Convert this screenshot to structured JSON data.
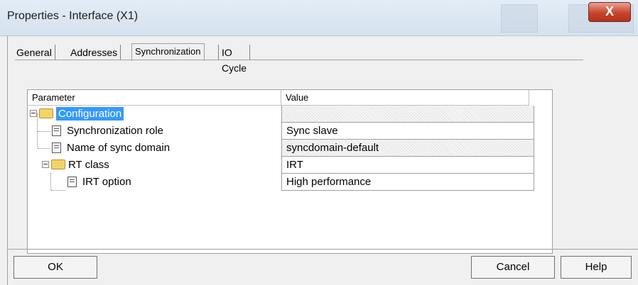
{
  "window": {
    "title": "Properties - Interface (X1)",
    "close_label": "X"
  },
  "tabs": [
    {
      "label": "General"
    },
    {
      "label": "Addresses"
    },
    {
      "label": "Synchronization",
      "active": true
    },
    {
      "label": "IO Cycle"
    }
  ],
  "table": {
    "columns": [
      "Parameter",
      "Value"
    ],
    "rows": [
      {
        "name": "Configuration",
        "value": ""
      },
      {
        "name": "Synchronization role",
        "value": "Sync slave"
      },
      {
        "name": "Name of sync domain",
        "value": "syncdomain-default"
      },
      {
        "name": "RT class",
        "value": "IRT"
      },
      {
        "name": "IRT option",
        "value": "High performance"
      }
    ]
  },
  "buttons": {
    "ok": "OK",
    "cancel": "Cancel",
    "help": "Help"
  },
  "colors": {
    "selection": "#3399ff",
    "close_button": "#c8442c"
  },
  "icons": [
    "folder-icon",
    "document-icon",
    "collapse-icon"
  ]
}
